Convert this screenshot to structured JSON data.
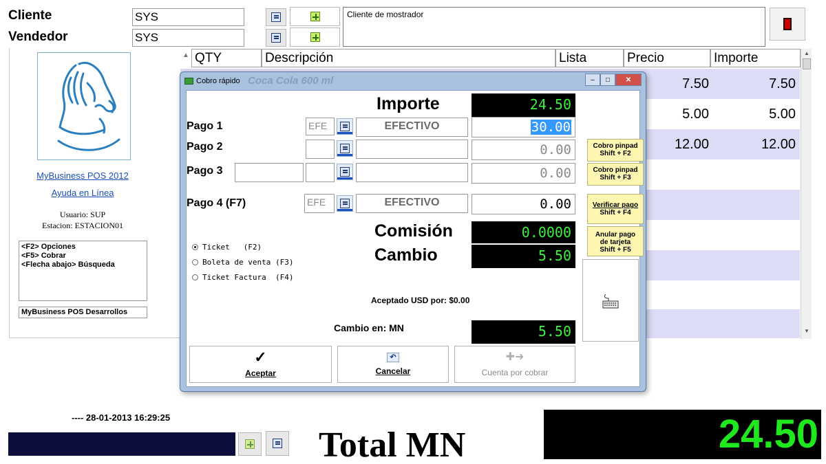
{
  "header": {
    "cliente_label": "Cliente",
    "cliente_value": "SYS",
    "vendedor_label": "Vendedor",
    "vendedor_value": "SYS",
    "client_description": "Cliente de mostrador"
  },
  "left_panel": {
    "app_link": "MyBusiness POS 2012",
    "help_link": "Ayuda en Línea",
    "usuario": "Usuario: SUP",
    "estacion": "Estacion: ESTACION01",
    "hints": [
      "<F2> Opciones",
      "<F5> Cobrar",
      "<Flecha abajo> Búsqueda"
    ],
    "developer": "MyBusiness POS Desarrollos"
  },
  "grid": {
    "columns": [
      "QTY",
      "Descripción",
      "Lista",
      "Precio",
      "Importe"
    ],
    "rows": [
      {
        "precio": "7.50",
        "importe": "7.50"
      },
      {
        "precio": "5.00",
        "importe": "5.00"
      },
      {
        "precio": "12.00",
        "importe": "12.00"
      }
    ]
  },
  "dialog": {
    "title": "Cobro rápido",
    "ghost_text": "Coca Cola 600 ml",
    "importe_label": "Importe",
    "importe_value": "24.50",
    "pagos": [
      {
        "label": "Pago 1",
        "code": "EFE",
        "desc": "EFECTIVO",
        "amount": "30.00"
      },
      {
        "label": "Pago 2",
        "code": "",
        "desc": "",
        "amount": "0.00"
      },
      {
        "label": "Pago 3",
        "code": "",
        "desc": "",
        "amount": "0.00"
      },
      {
        "label": "Pago 4 (F7)",
        "code": "EFE",
        "desc": "EFECTIVO",
        "amount": "0.00"
      }
    ],
    "buttons": {
      "cobro_pinpad_f2": [
        "Cobro pinpad",
        "Shift + F2"
      ],
      "cobro_pinpad_f3": [
        "Cobro pinpad",
        "Shift + F3"
      ],
      "verificar_pago": [
        "Verificar pago",
        "Shift + F4"
      ],
      "anular_pago": [
        "Anular pago",
        "de tarjeta",
        "Shift + F5"
      ]
    },
    "comision_label": "Comisión",
    "comision_value": "0.0000",
    "cambio_label": "Cambio",
    "cambio_value": "5.50",
    "radios": [
      {
        "label": "Ticket   (F2)",
        "selected": true
      },
      {
        "label": "Boleta de venta (F3)",
        "selected": false
      },
      {
        "label": "Ticket Factura  (F4)",
        "selected": false
      }
    ],
    "usd_text": "Aceptado USD por: $0.00",
    "cambio_en_label": "Cambio en: MN",
    "cambio_en_value": "5.50",
    "aceptar": "Aceptar",
    "cancelar": "Cancelar",
    "cuenta_por_cobrar": "Cuenta por cobrar"
  },
  "footer": {
    "datetime": "---- 28-01-2013 16:29:25",
    "total_label": "Total MN",
    "total_value": "24.50"
  }
}
